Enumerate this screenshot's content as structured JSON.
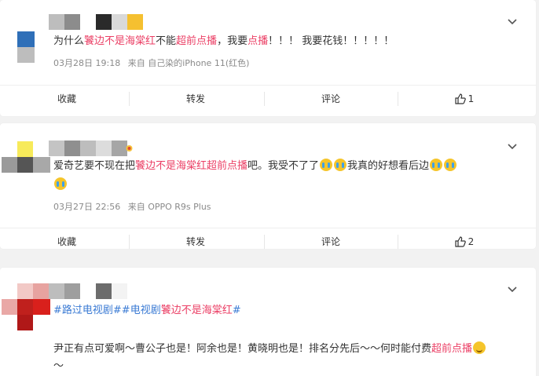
{
  "posts": [
    {
      "text": {
        "p1": "为什么",
        "h1": "饕边不是海棠红",
        "p2": "不能",
        "h2": "超前点播",
        "p3": "，我要",
        "h3": "点播",
        "p4": "！！！ 我要花钱！！！！！"
      },
      "date": "03月28日 19:18",
      "source": "来自 自己染的iPhone 11(红色)",
      "actions": {
        "collect": "收藏",
        "repost": "转发",
        "comment": "评论",
        "likes": "1"
      }
    },
    {
      "text": {
        "p1": "爱奇艺要不现在把",
        "h1": "饕边不是海棠红超前点播",
        "p2": "吧。我受不了了",
        "p3": "我真的好想看后边"
      },
      "date": "03月27日 22:56",
      "source": "来自 OPPO R9s Plus",
      "actions": {
        "collect": "收藏",
        "repost": "转发",
        "comment": "评论",
        "likes": "2"
      }
    },
    {
      "text": {
        "t1": "#路过电视剧#",
        "t2": "#电视剧",
        "h1": "饕边不是海棠红",
        "t3": "#",
        "p1": "尹正有点可爱啊～曹公子也是！阿余也是！黄晓明也是！排名分先后～～何时能付费",
        "h2": "超前点播",
        "p2": "～"
      }
    }
  ],
  "colors": {
    "highlight": "#eb3f65",
    "topic": "#3b7bd4"
  },
  "icons": {
    "more": "chevron-down-icon",
    "like": "thumbs-up-icon",
    "cry": "crying-face-emoji",
    "smile": "smiling-face-emoji"
  }
}
